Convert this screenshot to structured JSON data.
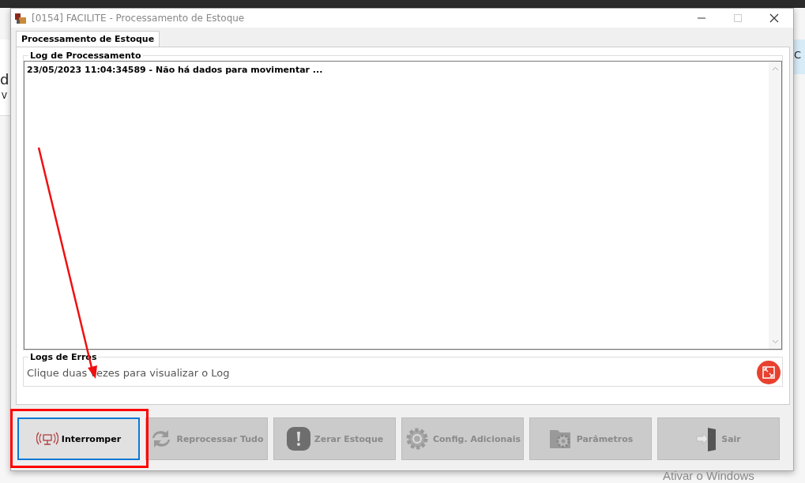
{
  "background": {
    "left_texts": [
      "d",
      "V"
    ],
    "right_texts": [
      "C"
    ]
  },
  "window": {
    "title": "[0154] FACILITE - Processamento de Estoque"
  },
  "tabs": [
    {
      "label": "Processamento de Estoque",
      "selected": true
    }
  ],
  "log_group": {
    "title": "Log de Processamento",
    "lines": [
      "23/05/2023 11:04:34589 - Não há dados para movimentar ..."
    ]
  },
  "errors_group": {
    "title": "Logs de Erros",
    "hint": "Clique duas vezes para visualizar o Log"
  },
  "buttons": [
    {
      "label": "Interromper",
      "kind": "signal",
      "disabled": false,
      "focused": true
    },
    {
      "label": "Reprocessar Tudo",
      "kind": "refresh",
      "disabled": true,
      "focused": false
    },
    {
      "label": "Zerar Estoque",
      "kind": "alert",
      "disabled": true,
      "focused": false
    },
    {
      "label": "Config. Adicionais",
      "kind": "gear",
      "disabled": true,
      "focused": false
    },
    {
      "label": "Parâmetros",
      "kind": "folder-gear",
      "disabled": true,
      "focused": false
    },
    {
      "label": "Sair",
      "kind": "exit",
      "disabled": true,
      "focused": false
    }
  ],
  "annotations": {
    "arrow": true,
    "highlight": true
  },
  "os_notice": "Ativar o Windows"
}
